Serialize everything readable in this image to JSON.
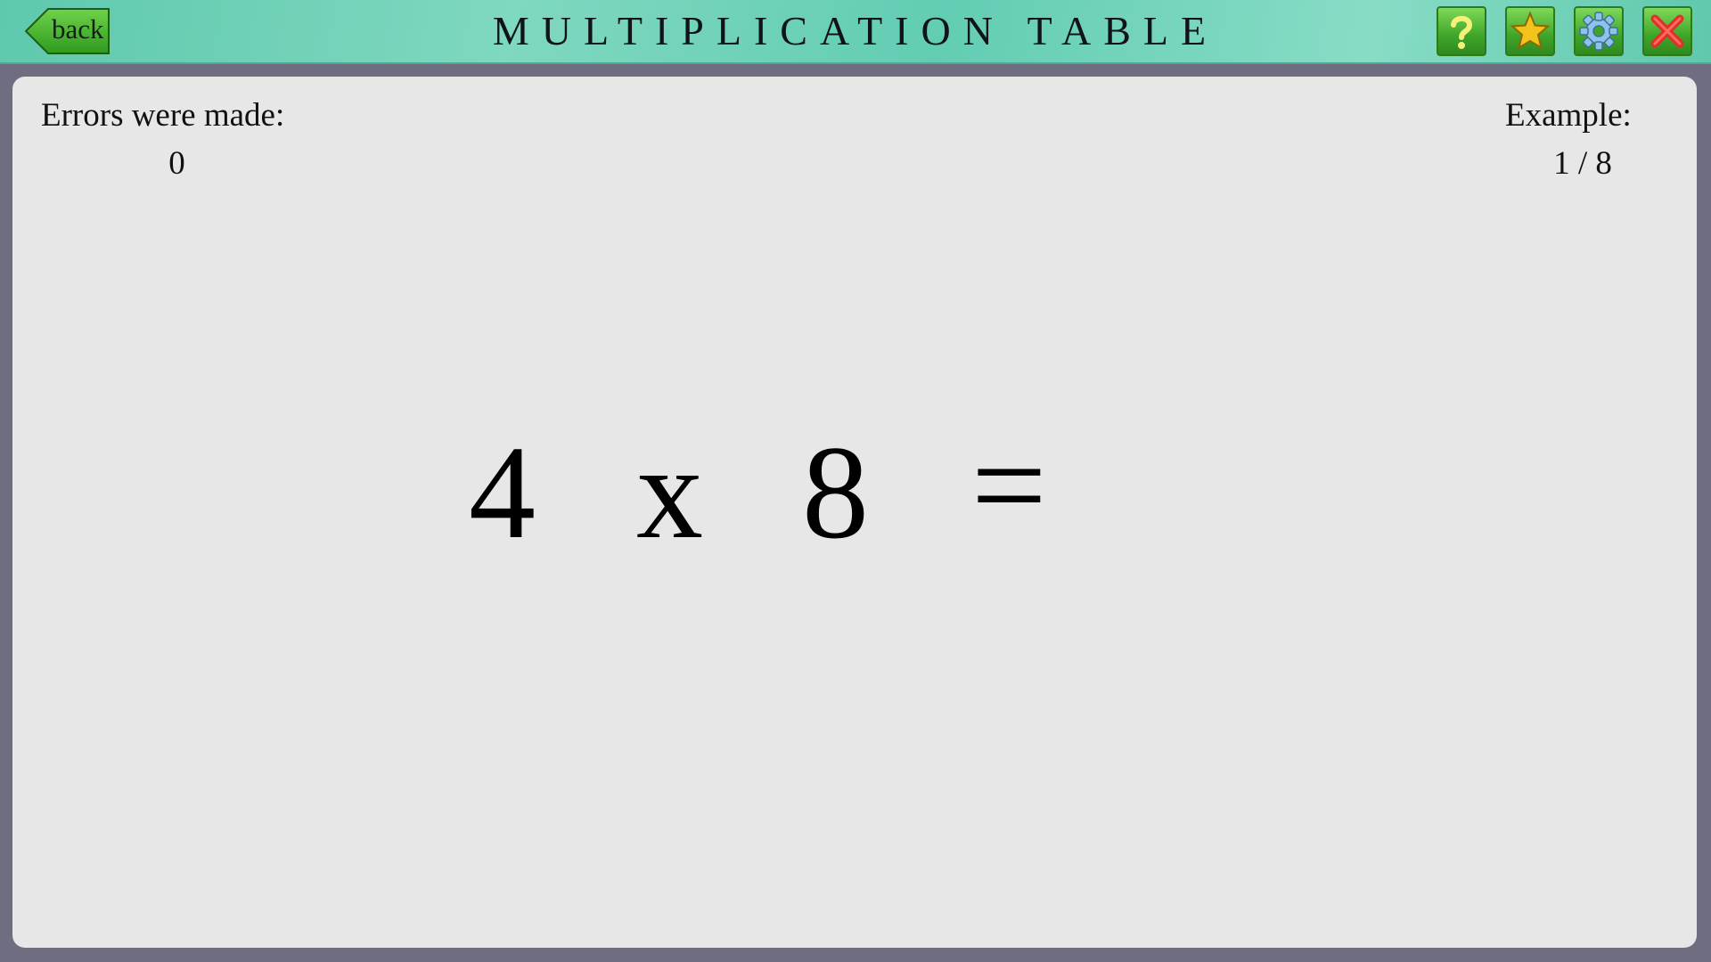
{
  "header": {
    "title": "MULTIPLICATION TABLE",
    "back_label": "back",
    "icons": {
      "help": "help-icon",
      "favorites": "star-icon",
      "settings": "gear-icon",
      "close": "close-icon"
    }
  },
  "stats": {
    "errors_label": "Errors were made:",
    "errors_value": "0",
    "example_label": "Example:",
    "example_value": "1 / 8"
  },
  "equation": {
    "operand_a": "4",
    "operator": "x",
    "operand_b": "8",
    "equals": "="
  },
  "colors": {
    "header": "#6fd1b7",
    "button_green": "#3fa529",
    "panel": "#e7e7e7",
    "frame": "#6f6e80",
    "close_red": "#e0302a"
  }
}
